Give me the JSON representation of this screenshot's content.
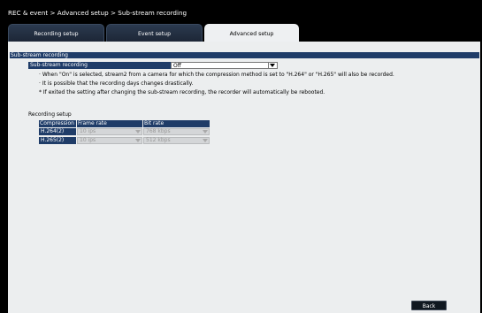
{
  "breadcrumb": "REC & event > Advanced setup > Sub-stream recording",
  "tabs": [
    {
      "label": "Recording setup",
      "active": false
    },
    {
      "label": "Event setup",
      "active": false
    },
    {
      "label": "Advanced setup",
      "active": true
    }
  ],
  "section": {
    "title": "Sub-stream recording",
    "field_label": "Sub-stream recording",
    "field_value": "Off",
    "notes": [
      "· When \"On\" is selected, stream2 from a camera for which the compression method is set to \"H.264\" or \"H.265\" will also be recorded.",
      "· It is possible that the recording days changes drastically.",
      "* If exited the setting after changing the sub-stream recording, the recorder will automatically be rebooted."
    ]
  },
  "recording_setup": {
    "title": "Recording setup",
    "headers": [
      "Compression",
      "Frame rate",
      "Bit rate"
    ],
    "rows": [
      {
        "compression": "H.264(2)",
        "frame_rate": "10 ips",
        "bit_rate": "768 kbps"
      },
      {
        "compression": "H.265(2)",
        "frame_rate": "10 ips",
        "bit_rate": "512 kbps"
      }
    ]
  },
  "back_label": "Back",
  "colors": {
    "header_bg": "#1f3c68",
    "panel_bg": "#eceeef",
    "screen_bg": "#000000"
  }
}
